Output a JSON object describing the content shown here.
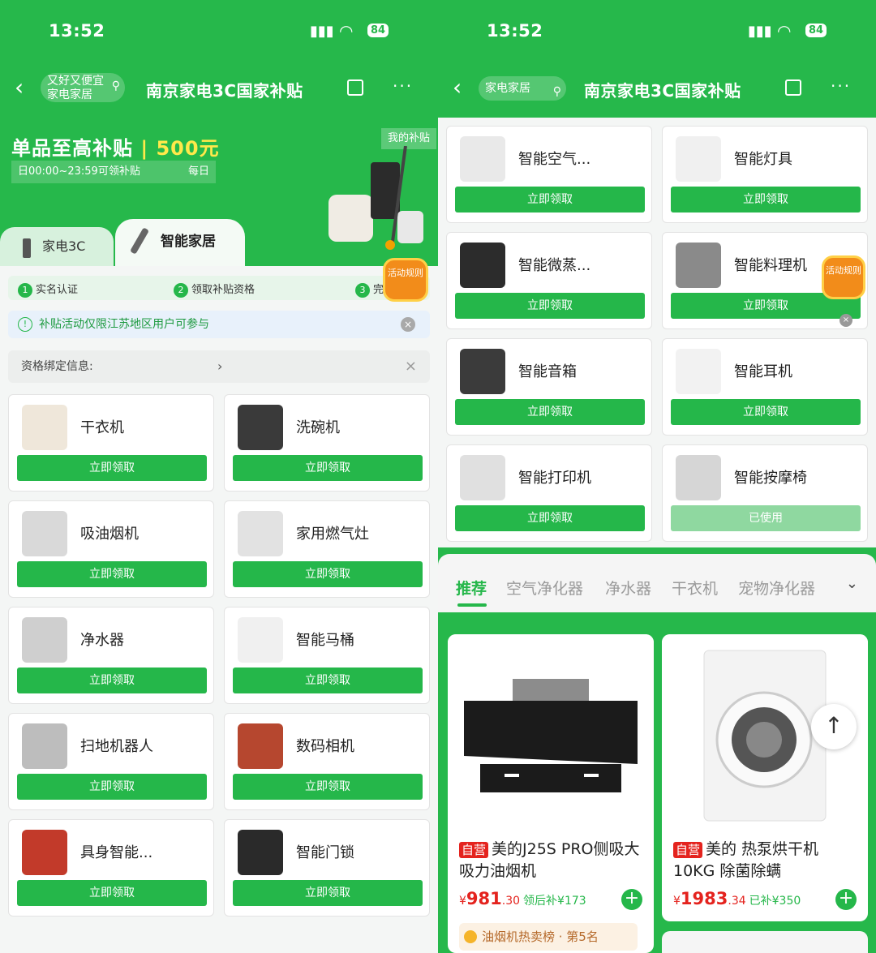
{
  "status": {
    "time": "13:52",
    "signal": "::!!",
    "battery": "84"
  },
  "left": {
    "search_pill": {
      "line1": "又好又便宜",
      "line2": "家电家居"
    },
    "title": "南京家电3C国家补贴",
    "banner": {
      "headline": "单品至高补贴",
      "amount": "500元",
      "time_range": "日00:00~23:59可领补贴",
      "daily": "每日",
      "my_subsidy": "我的补贴"
    },
    "tabs": [
      {
        "label": "家电3C"
      },
      {
        "label": "智能家居"
      }
    ],
    "steps": [
      {
        "num": "1",
        "label": "实名认证"
      },
      {
        "num": "2",
        "label": "领取补贴资格"
      },
      {
        "num": "3",
        "label": "完"
      }
    ],
    "activity_badge": "活动规则",
    "notice": "补贴活动仅限江苏地区用户可参与",
    "bind_label": "资格绑定信息:",
    "cards": [
      {
        "name": "干衣机",
        "btn": "立即领取"
      },
      {
        "name": "洗碗机",
        "btn": "立即领取"
      },
      {
        "name": "吸油烟机",
        "btn": "立即领取"
      },
      {
        "name": "家用燃气灶",
        "btn": "立即领取"
      },
      {
        "name": "净水器",
        "btn": "立即领取"
      },
      {
        "name": "智能马桶",
        "btn": "立即领取"
      },
      {
        "name": "扫地机器人",
        "btn": "立即领取"
      },
      {
        "name": "数码相机",
        "btn": "立即领取"
      },
      {
        "name": "具身智能...",
        "btn": "立即领取"
      },
      {
        "name": "智能门锁",
        "btn": "立即领取"
      }
    ]
  },
  "right": {
    "search_pill": "家电家居",
    "title": "南京家电3C国家补贴",
    "cards": [
      {
        "name": "智能空气...",
        "btn": "立即领取"
      },
      {
        "name": "智能灯具",
        "btn": "立即领取"
      },
      {
        "name": "智能微蒸...",
        "btn": "立即领取"
      },
      {
        "name": "智能料理机",
        "btn": "立即领取"
      },
      {
        "name": "智能音箱",
        "btn": "立即领取"
      },
      {
        "name": "智能耳机",
        "btn": "立即领取"
      },
      {
        "name": "智能打印机",
        "btn": "立即领取"
      },
      {
        "name": "智能按摩椅",
        "btn": "已使用"
      }
    ],
    "activity_badge": "活动规则",
    "category_tabs": [
      "推荐",
      "空气净化器",
      "净水器",
      "干衣机",
      "宠物净化器"
    ],
    "products": [
      {
        "tag": "自营",
        "title": "美的J25S PRO侧吸大吸力油烟机",
        "currency": "¥",
        "price_int": "981",
        "price_dec": ".30",
        "after": "领后补¥173",
        "rank": "油烟机热卖榜 · 第5名"
      },
      {
        "tag": "自营",
        "title": "美的 热泵烘干机 10KG 除菌除螨",
        "currency": "¥",
        "price_int": "1983",
        "price_dec": ".34",
        "after": "已补¥350"
      }
    ]
  },
  "colors": {
    "brand_green": "#25b74a",
    "price_red": "#e4231e",
    "badge_orange": "#f28c1a"
  }
}
